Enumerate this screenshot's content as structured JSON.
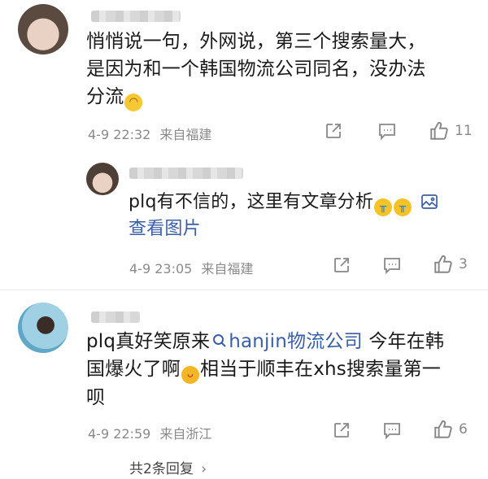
{
  "comments": [
    {
      "text_line1": "悄悄说一句，外网说，第三个搜索量大，",
      "text_line2": "是因为和一个韩国物流公司同名，没办法",
      "text_line3": "分流",
      "timestamp": "4-9 22:32",
      "location": "来自福建",
      "like_count": "11",
      "reply": {
        "text_line1": "plq有不信的，这里有文章分析",
        "view_image_label": "查看图片",
        "timestamp": "4-9 23:05",
        "location": "来自福建",
        "like_count": "3"
      }
    },
    {
      "text_prefix": "plq真好笑原来",
      "search_link": "hanjin物流公司",
      "text_after_link": " 今年在韩",
      "text_line2": "国爆火了啊",
      "text_line2_after": "相当于顺丰在xhs搜索量第一",
      "text_line3": "呗",
      "timestamp": "4-9 22:59",
      "location": "来自浙江",
      "like_count": "6",
      "more_replies": "共2条回复",
      "chevron": "›"
    }
  ],
  "icons": [
    "share-icon",
    "comment-icon",
    "like-icon",
    "image-icon",
    "search-icon",
    "chevron-right-icon"
  ],
  "colors": {
    "link": "#3b5ea8",
    "meta": "#8a8a8a",
    "icon": "#888888"
  }
}
